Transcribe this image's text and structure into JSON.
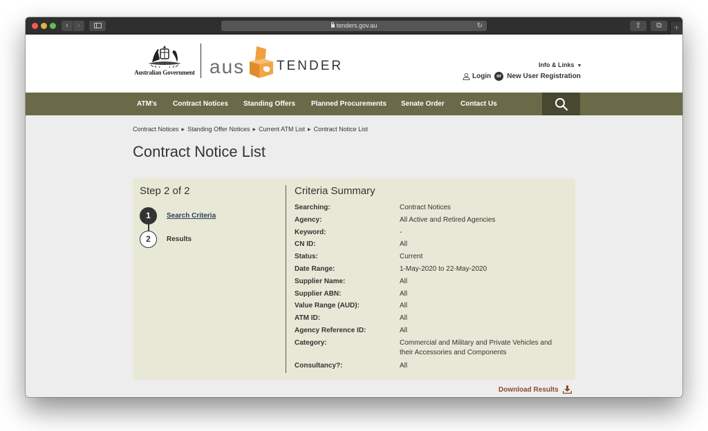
{
  "browser": {
    "url": "tenders.gov.au",
    "back_glyph": "‹",
    "forward_glyph": "›",
    "reload_glyph": "↻",
    "share_glyph": "⇪",
    "tabs_glyph": "⧉",
    "newtab_glyph": "+"
  },
  "header": {
    "gov_name": "Australian Government",
    "brand_aus": "aus",
    "brand_tender": "TENDER",
    "info_links_label": "Info & Links",
    "info_links_caret": "▼",
    "login_label": "Login",
    "or_label": "or",
    "register_label": "New User Registration"
  },
  "nav": {
    "items": [
      {
        "label": "ATM's"
      },
      {
        "label": "Contract Notices"
      },
      {
        "label": "Standing Offers"
      },
      {
        "label": "Planned Procurements"
      },
      {
        "label": "Senate Order"
      },
      {
        "label": "Contact Us"
      }
    ]
  },
  "breadcrumb": {
    "items": [
      "Contract Notices",
      "Standing Offer Notices",
      "Current ATM List",
      "Contract Notice List"
    ],
    "separator": "▶"
  },
  "page": {
    "title": "Contract Notice List"
  },
  "steps": {
    "heading": "Step 2 of 2",
    "items": [
      {
        "number": "1",
        "label": "Search Criteria"
      },
      {
        "number": "2",
        "label": "Results"
      }
    ]
  },
  "criteria": {
    "heading": "Criteria Summary",
    "rows": [
      {
        "label": "Searching:",
        "value": "Contract Notices"
      },
      {
        "label": "Agency:",
        "value": "All Active and Retired Agencies"
      },
      {
        "label": "Keyword:",
        "value": "-"
      },
      {
        "label": "CN ID:",
        "value": "All"
      },
      {
        "label": "Status:",
        "value": "Current"
      },
      {
        "label": "Date Range:",
        "value": "1-May-2020 to 22-May-2020"
      },
      {
        "label": "Supplier Name:",
        "value": "All"
      },
      {
        "label": "Supplier ABN:",
        "value": "All"
      },
      {
        "label": "Value Range (AUD):",
        "value": "All"
      },
      {
        "label": "ATM ID:",
        "value": "All"
      },
      {
        "label": "Agency Reference ID:",
        "value": "All"
      },
      {
        "label": "Category:",
        "value": "Commercial and Military and Private Vehicles and their Accessories and Components"
      },
      {
        "label": "Consultancy?:",
        "value": "All"
      }
    ]
  },
  "actions": {
    "download_label": "Download Results"
  },
  "colors": {
    "nav_bg": "#6b6a48",
    "search_bg": "#48472f",
    "panel_bg": "#e8e8d6",
    "download_color": "#8a4a2e",
    "brand_orange": "#f0a040"
  }
}
